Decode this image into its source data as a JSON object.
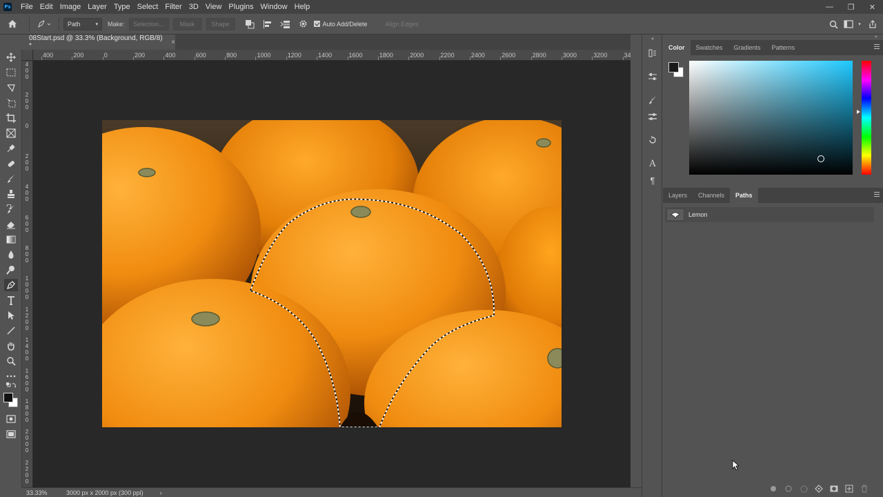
{
  "app": {
    "logo": "Ps"
  },
  "menu": [
    "File",
    "Edit",
    "Image",
    "Layer",
    "Type",
    "Select",
    "Filter",
    "3D",
    "View",
    "Plugins",
    "Window",
    "Help"
  ],
  "window_controls": {
    "minimize": "—",
    "restore": "❐",
    "close": "✕"
  },
  "options_bar": {
    "mode_value": "Path",
    "make_label": "Make:",
    "selection_button": "Selection...",
    "mask_button": "Mask",
    "shape_button": "Shape",
    "auto_add_delete_label": "Auto Add/Delete",
    "auto_add_delete_checked": true,
    "align_edges_label": "Align Edges"
  },
  "document_tab": {
    "title": "08Start.psd @ 33.3% (Background, RGB/8) *",
    "close": "×"
  },
  "rulers": {
    "horizontal": [
      "400",
      "200",
      "0",
      "200",
      "400",
      "600",
      "800",
      "1000",
      "1200",
      "1400",
      "1600",
      "1800",
      "2000",
      "2200",
      "2400",
      "2600",
      "2800",
      "3000",
      "3200",
      "34"
    ],
    "vertical": [
      [
        "4",
        "0",
        "0"
      ],
      [
        "2",
        "0",
        "0"
      ],
      [
        "0"
      ],
      [
        "2",
        "0",
        "0"
      ],
      [
        "4",
        "0",
        "0"
      ],
      [
        "6",
        "0",
        "0"
      ],
      [
        "8",
        "0",
        "0"
      ],
      [
        "1",
        "0",
        "0",
        "0"
      ],
      [
        "1",
        "2",
        "0",
        "0"
      ],
      [
        "1",
        "4",
        "0",
        "0"
      ],
      [
        "1",
        "6",
        "0",
        "0"
      ],
      [
        "1",
        "8",
        "0",
        "0"
      ],
      [
        "2",
        "0",
        "0",
        "0"
      ],
      [
        "2",
        "2",
        "0",
        "0"
      ]
    ]
  },
  "status_bar": {
    "zoom": "33.33%",
    "doc_info": "3000 px x 2000 px (300 ppi)",
    "arrow": "›"
  },
  "color_panel": {
    "tabs": [
      "Color",
      "Swatches",
      "Gradients",
      "Patterns"
    ],
    "active_tab": "Color",
    "foreground_color": "#1a1a1a",
    "background_color": "#ffffff",
    "field_hue_color": "#1ec8ff"
  },
  "layers_panel": {
    "tabs": [
      "Layers",
      "Channels",
      "Paths"
    ],
    "active_tab": "Paths",
    "paths": [
      {
        "name": "Lemon"
      }
    ]
  },
  "colors": {
    "ui_bg": "#535353",
    "ui_dark": "#424242",
    "canvas_bg": "#282828",
    "orange": "#f08c10"
  }
}
